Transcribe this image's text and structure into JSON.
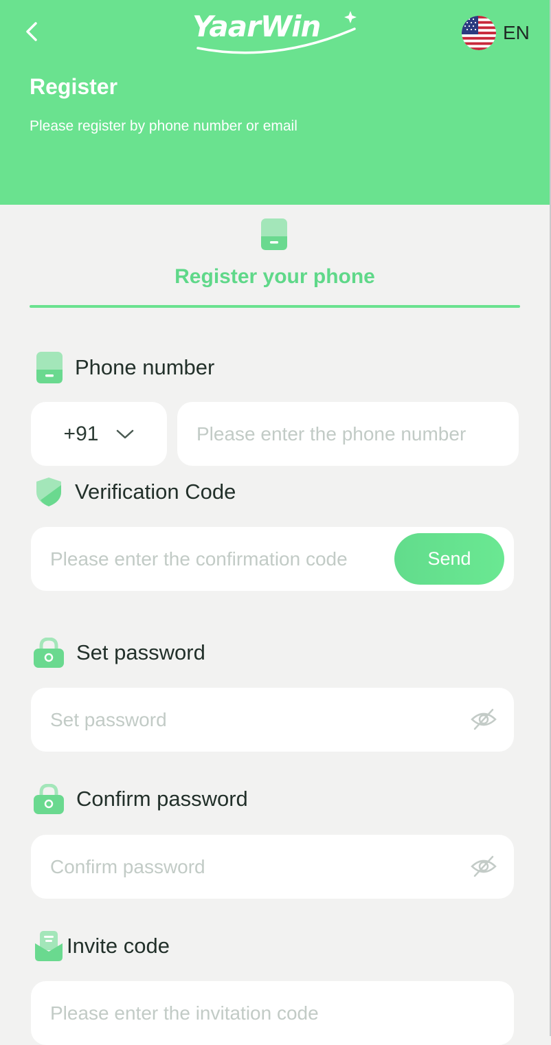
{
  "header": {
    "brand": "YaarWin",
    "language": "EN",
    "title": "Register",
    "subtitle": "Please register by phone number or email"
  },
  "tab": {
    "label": "Register your phone"
  },
  "form": {
    "phone": {
      "label": "Phone number",
      "country_code": "+91",
      "placeholder": "Please enter the phone number"
    },
    "verification": {
      "label": "Verification Code",
      "placeholder": "Please enter the confirmation code",
      "send_label": "Send"
    },
    "password": {
      "label": "Set password",
      "placeholder": "Set password"
    },
    "confirm_password": {
      "label": "Confirm password",
      "placeholder": "Confirm password"
    },
    "invite": {
      "label": "Invite code",
      "placeholder": "Please enter the invitation code"
    }
  },
  "icons": {
    "back": "chevron-left-icon",
    "flag": "us-flag-icon",
    "phone": "phone-icon",
    "shield": "shield-icon",
    "lock": "lock-icon",
    "eye_hidden": "eye-off-icon",
    "invite": "invite-icon"
  },
  "colors": {
    "accent": "#6ae28f",
    "accent_text": "#5fd889",
    "background": "#f2f2f1"
  }
}
